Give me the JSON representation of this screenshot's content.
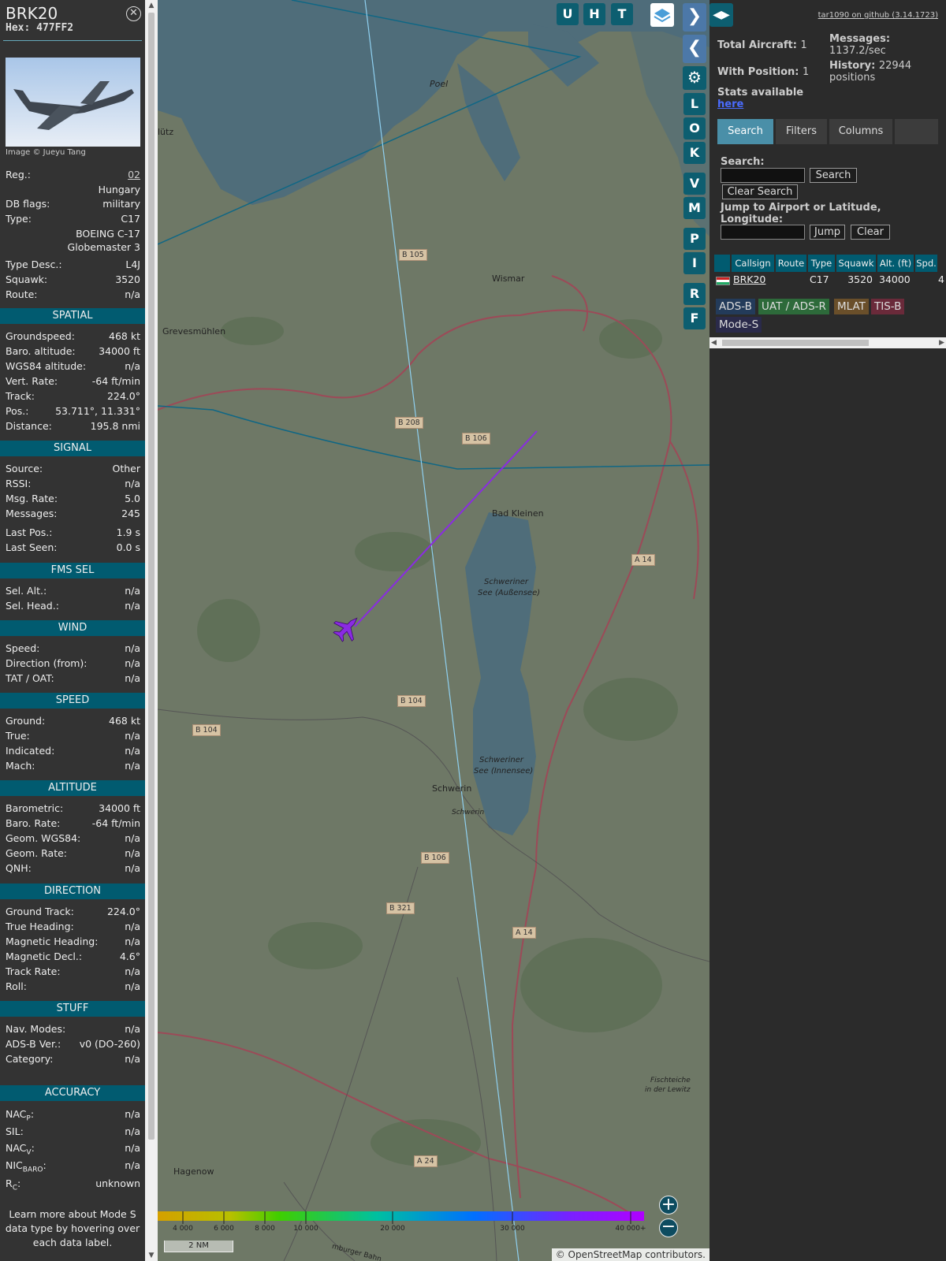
{
  "aircraft": {
    "callsign": "BRK20",
    "hex_label": "Hex:",
    "hex": "477FF2",
    "image_credit": "Image © Jueyu Tang"
  },
  "info": {
    "reg_label": "Reg.:",
    "reg": "02",
    "country": "Hungary",
    "dbflags_label": "DB flags:",
    "dbflags": "military",
    "type_label": "Type:",
    "type": "C17",
    "type_line1": "BOEING C-17",
    "type_line2": "Globemaster 3",
    "typedesc_label": "Type Desc.:",
    "typedesc": "L4J",
    "squawk_label": "Squawk:",
    "squawk": "3520",
    "route_label": "Route:",
    "route": "n/a"
  },
  "sections": {
    "spatial": "SPATIAL",
    "signal": "SIGNAL",
    "fms": "FMS SEL",
    "wind": "WIND",
    "speed": "SPEED",
    "altitude": "ALTITUDE",
    "direction": "DIRECTION",
    "stuff": "STUFF",
    "accuracy": "ACCURACY"
  },
  "spatial": [
    {
      "k": "Groundspeed:",
      "v": "468 kt"
    },
    {
      "k": "Baro. altitude:",
      "v": "34000 ft"
    },
    {
      "k": "WGS84 altitude:",
      "v": "n/a"
    },
    {
      "k": "Vert. Rate:",
      "v": "-64 ft/min"
    },
    {
      "k": "Track:",
      "v": "224.0°"
    },
    {
      "k": "Pos.:",
      "v": "53.711°, 11.331°"
    },
    {
      "k": "Distance:",
      "v": "195.8 nmi"
    }
  ],
  "signal": [
    {
      "k": "Source:",
      "v": "Other"
    },
    {
      "k": "RSSI:",
      "v": "n/a"
    },
    {
      "k": "Msg. Rate:",
      "v": "5.0"
    },
    {
      "k": "Messages:",
      "v": "245"
    },
    {
      "k": "Last Pos.:",
      "v": "1.9 s"
    },
    {
      "k": "Last Seen:",
      "v": "0.0 s"
    }
  ],
  "fms": [
    {
      "k": "Sel. Alt.:",
      "v": "n/a"
    },
    {
      "k": "Sel. Head.:",
      "v": "n/a"
    }
  ],
  "wind": [
    {
      "k": "Speed:",
      "v": "n/a"
    },
    {
      "k": "Direction (from):",
      "v": "n/a"
    },
    {
      "k": "TAT / OAT:",
      "v": "n/a"
    }
  ],
  "speed": [
    {
      "k": "Ground:",
      "v": "468 kt"
    },
    {
      "k": "True:",
      "v": "n/a"
    },
    {
      "k": "Indicated:",
      "v": "n/a"
    },
    {
      "k": "Mach:",
      "v": "n/a"
    }
  ],
  "altitude": [
    {
      "k": "Barometric:",
      "v": "34000 ft"
    },
    {
      "k": "Baro. Rate:",
      "v": "-64 ft/min"
    },
    {
      "k": "Geom. WGS84:",
      "v": "n/a"
    },
    {
      "k": "Geom. Rate:",
      "v": "n/a"
    },
    {
      "k": "QNH:",
      "v": "n/a"
    }
  ],
  "direction": [
    {
      "k": "Ground Track:",
      "v": "224.0°"
    },
    {
      "k": "True Heading:",
      "v": "n/a"
    },
    {
      "k": "Magnetic Heading:",
      "v": "n/a"
    },
    {
      "k": "Magnetic Decl.:",
      "v": "4.6°"
    },
    {
      "k": "Track Rate:",
      "v": "n/a"
    },
    {
      "k": "Roll:",
      "v": "n/a"
    }
  ],
  "stuff": [
    {
      "k": "Nav. Modes:",
      "v": "n/a"
    },
    {
      "k": "ADS-B Ver.:",
      "v": "v0 (DO-260)"
    },
    {
      "k": "Category:",
      "v": "n/a"
    }
  ],
  "accuracy": [
    {
      "k": "NACP:",
      "base": "NAC",
      "sub": "P",
      "v": "n/a"
    },
    {
      "k": "SIL:",
      "base": "SIL",
      "sub": "",
      "v": "n/a"
    },
    {
      "k": "NACV:",
      "base": "NAC",
      "sub": "V",
      "v": "n/a"
    },
    {
      "k": "NICBARO:",
      "base": "NIC",
      "sub": "BARO",
      "v": "n/a"
    },
    {
      "k": "RC:",
      "base": "R",
      "sub": "C",
      "v": "unknown"
    }
  ],
  "footer_note": "Learn more about Mode S data type by hovering over each data label.",
  "map_buttons": {
    "u": "U",
    "h": "H",
    "t": "T",
    "l": "L",
    "o": "O",
    "k": "K",
    "v": "V",
    "m": "M",
    "p": "P",
    "i": "I",
    "r": "R",
    "f": "F"
  },
  "map_labels": {
    "poel": "Poel",
    "wismar": "Wismar",
    "grevesmuhlen": "Grevesmühlen",
    "bad_kleinen": "Bad Kleinen",
    "schwerin": "Schwerin",
    "schweriner_aussen_1": "Schweriner",
    "schweriner_aussen_2": "See (Außensee)",
    "schweriner_innen_1": "Schweriner",
    "schweriner_innen_2": "See (Innensee)",
    "schwerin_small": "Schwerin",
    "hagenow": "Hagenow",
    "klutz": "lütz",
    "fischteiche_1": "Fischteiche",
    "fischteiche_2": "in der Lewitz",
    "b105": "B 105",
    "b208": "B 208",
    "b106a": "B 106",
    "a14a": "A 14",
    "b104a": "B 104",
    "b104b": "B 104",
    "b106b": "B 106",
    "b321": "B 321",
    "a14b": "A 14",
    "a24": "A 24",
    "hamburger_bahn": "mburger Bahn"
  },
  "altitude_scale": {
    "labels": [
      "4 000",
      "6 000",
      "8 000",
      "10 000",
      "20 000",
      "30 000",
      "40 000+"
    ]
  },
  "scale_bar": "2 NM",
  "attribution": "© OpenStreetMap contributors.",
  "stats": {
    "github": "tar1090 on github (3.14.1723)",
    "total_label": "Total Aircraft:",
    "total": "1",
    "messages_label": "Messages:",
    "messages": "1137.2/sec",
    "with_pos_label": "With Position:",
    "with_pos": "1",
    "history_label": "History:",
    "history": "22944 positions",
    "stats_avail": "Stats available",
    "stats_link": "here"
  },
  "tabs": [
    "Search",
    "Filters",
    "Columns"
  ],
  "search": {
    "label": "Search:",
    "search_btn": "Search",
    "clear_btn": "Clear Search",
    "jump_label": "Jump to Airport or Latitude, Longitude:",
    "jump_btn": "Jump",
    "clear2_btn": "Clear"
  },
  "table": {
    "headers": [
      "",
      "Callsign",
      "Route",
      "Type",
      "Squawk",
      "Alt. (ft)",
      "Spd."
    ],
    "rows": [
      {
        "callsign": "BRK20",
        "route": "",
        "type": "C17",
        "squawk": "3520",
        "alt": "34000",
        "spd": "4"
      }
    ]
  },
  "legend": {
    "adsb": "ADS-B",
    "uat": "UAT / ADS-R",
    "mlat": "MLAT",
    "tisb": "TIS-B",
    "modes": "Mode-S"
  },
  "colors": {
    "accent": "#015b70",
    "track": "#8a2be2",
    "aircraft": "#8a2be2"
  }
}
